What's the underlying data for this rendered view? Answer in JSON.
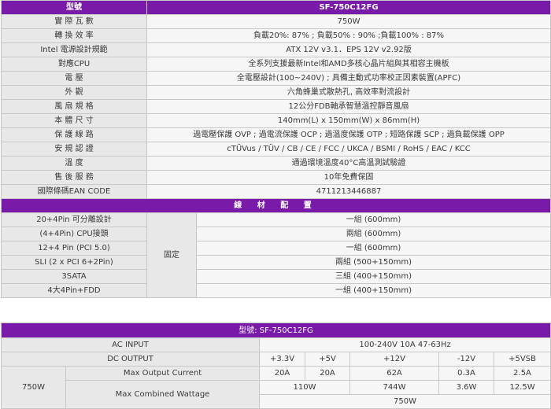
{
  "spec_table": {
    "header": {
      "label": "型號",
      "value": "SF-750C12FG"
    },
    "rows": [
      {
        "label": "實 際 瓦 數",
        "value": "750W"
      },
      {
        "label": "轉 換 效 率",
        "value": "負載20%: 87% ; 負載50% : 90% ;負載100% : 87%"
      },
      {
        "label": "Intel 電源設計規範",
        "value": "ATX 12V v3.1．EPS 12V v2.92版"
      },
      {
        "label": "對應CPU",
        "value": "全系列支援最新Intel和AMD多核心晶片組與其相容主機板"
      },
      {
        "label": "電 壓",
        "value": "全電壓設計(100~240V) ; 具備主動式功率校正因素裝置(APFC)"
      },
      {
        "label": "外 觀",
        "value": "六角蜂巢式散熱孔, 高效率對流設計"
      },
      {
        "label": "風 扇 規 格",
        "value": "12公分FDB軸承智慧溫控靜音風扇"
      },
      {
        "label": "本 體 尺 寸",
        "value": "140mm(L) x 150mm(W) x 86mm(H)"
      },
      {
        "label": "保 護 線 路",
        "value": "過電壓保護 OVP ; 過電流保護 OCP ; 過溫度保護 OTP ; 短路保護 SCP ; 過負載保護 OPP"
      },
      {
        "label": "安 規 認 證",
        "value": "cTÜVus / TÜV / CB / CE / FCC / UKCA / BSMI / RoHS / EAC / KCC"
      },
      {
        "label": "溫 度",
        "value": "通過環境溫度40°C高溫測試驗證"
      },
      {
        "label": "售 後 服 務",
        "value": "10年免費保固"
      },
      {
        "label": "國際條碼EAN CODE",
        "value": "4711213446887"
      }
    ],
    "cable_section_title": "線 材 配 置",
    "cable_group_label": "固定",
    "cables": [
      {
        "label": "20+4Pin 可分離設計",
        "value": "一組 (600mm)"
      },
      {
        "label": "(4+4Pin) CPU接頭",
        "value": "兩組 (600mm)"
      },
      {
        "label": "12+4 Pin (PCI 5.0)",
        "value": "一組 (600mm)"
      },
      {
        "label": "SLI (2 x PCI 6+2Pin)",
        "value": "兩組 (500+150mm)"
      },
      {
        "label": "3SATA",
        "value": "三組 (400+150mm)"
      },
      {
        "label": "4大4Pin+FDD",
        "value": "一組 (400+150mm)"
      }
    ]
  },
  "psu_table": {
    "title": "型號: SF-750C12FG",
    "ac_input_label": "AC INPUT",
    "ac_input_value": "100-240V 10A 47-63Hz",
    "dc_output_label": "DC OUTPUT",
    "rails": [
      "+3.3V",
      "+5V",
      "+12V",
      "-12V",
      "+5VSB"
    ],
    "wattage_label": "750W",
    "max_current_label": "Max Output Current",
    "max_currents": [
      "20A",
      "20A",
      "62A",
      "0.3A",
      "2.5A"
    ],
    "combined_label": "Max Combined Wattage",
    "combined_33_5": "110W",
    "combined_12": "744W",
    "combined_n12": "3.6W",
    "combined_5vsb": "12.5W",
    "total_wattage": "750W"
  },
  "colors": {
    "header_purple": "#7a1aa8",
    "label_bg": "#e8e8e8",
    "value_bg": "#f6f6f6"
  }
}
